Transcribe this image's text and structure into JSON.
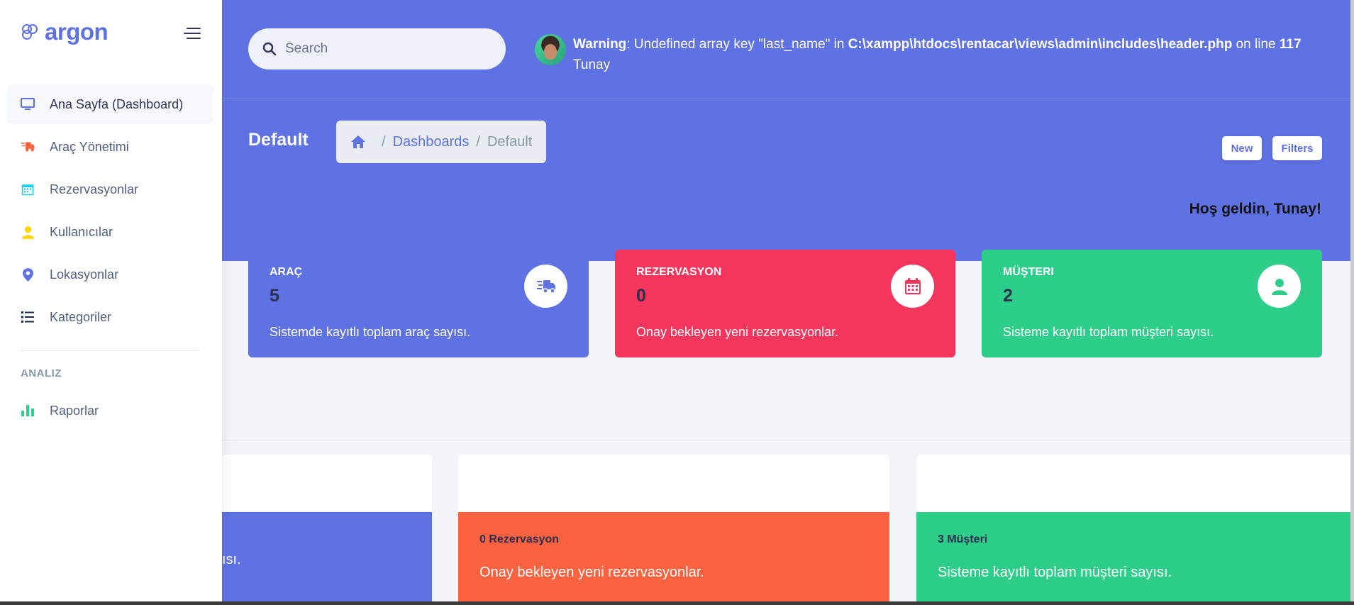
{
  "brand": {
    "name": "argon"
  },
  "search": {
    "placeholder": "Search"
  },
  "user": {
    "warning_prefix": "Warning",
    "warning_text": ": Undefined array key \"last_name\" in ",
    "warning_path": "C:\\xampp\\htdocs\\rentacar\\views\\admin\\includes\\header.php",
    "warning_on_line": " on line ",
    "warning_line": "117",
    "name": "Tunay"
  },
  "header": {
    "title": "Default",
    "breadcrumb": [
      "Dashboards",
      "Default"
    ],
    "separator": "/",
    "new_label": "New",
    "filters_label": "Filters",
    "welcome": "Hoş geldin, Tunay!"
  },
  "sidebar": {
    "items": [
      {
        "label": "Ana Sayfa (Dashboard)",
        "icon": "monitor-icon",
        "color": "#5e72e4"
      },
      {
        "label": "Araç Yönetimi",
        "icon": "truck-icon",
        "color": "#fb6340"
      },
      {
        "label": "Rezervasyonlar",
        "icon": "calendar-icon",
        "color": "#11cdef"
      },
      {
        "label": "Kullanıcılar",
        "icon": "user-icon",
        "color": "#ffd600"
      },
      {
        "label": "Lokasyonlar",
        "icon": "location-pin-icon",
        "color": "#5e72e4"
      },
      {
        "label": "Kategoriler",
        "icon": "list-icon",
        "color": "#172b4d"
      }
    ],
    "section_heading": "ANALIZ",
    "analysis_items": [
      {
        "label": "Raporlar",
        "icon": "bar-chart-icon",
        "color": "#2dce89"
      }
    ]
  },
  "stats": [
    {
      "label": "ARAÇ",
      "value": "5",
      "desc": "Sistemde kayıtlı toplam araç sayısı.",
      "icon": "truck-icon",
      "color": "#5e72e4"
    },
    {
      "label": "REZERVASYON",
      "value": "0",
      "desc": "Onay bekleyen yeni rezervasyonlar.",
      "icon": "calendar-icon",
      "color": "#f5365c"
    },
    {
      "label": "MÜŞTERI",
      "value": "2",
      "desc": "Sisteme kayıtlı toplam müşteri sayısı.",
      "icon": "user-icon",
      "color": "#2dce89"
    }
  ],
  "bottom_cards": [
    {
      "count": "",
      "desc": "ısı."
    },
    {
      "count": "0 Rezervasyon",
      "desc": "Onay bekleyen yeni rezervasyonlar."
    },
    {
      "count": "3 Müşteri",
      "desc": "Sisteme kayıtlı toplam müşteri sayısı."
    }
  ]
}
